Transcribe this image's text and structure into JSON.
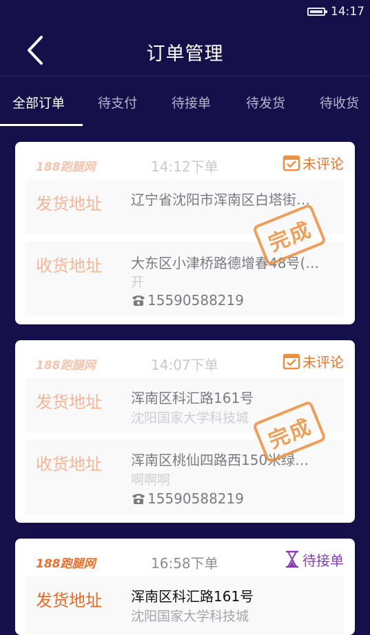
{
  "status_bar": {
    "time": "14:17"
  },
  "header": {
    "title": "订单管理"
  },
  "tabs": [
    {
      "label": "全部订单",
      "active": true
    },
    {
      "label": "待支付",
      "active": false
    },
    {
      "label": "待接单",
      "active": false
    },
    {
      "label": "待发货",
      "active": false
    },
    {
      "label": "待收货",
      "active": false
    }
  ],
  "orders": [
    {
      "logo": "188跑腿网",
      "time": "14:12下单",
      "status": "未评论",
      "status_icon": "check-calendar-icon",
      "stamp": "完成",
      "sender": {
        "label": "发货地址",
        "address": "辽宁省沈阳市浑南区白塔街…",
        "detail": ""
      },
      "receiver": {
        "label": "收货地址",
        "address": "大东区小津桥路德增春48号(…",
        "detail": "开",
        "phone": "15590588219"
      }
    },
    {
      "logo": "188跑腿网",
      "time": "14:07下单",
      "status": "未评论",
      "status_icon": "check-calendar-icon",
      "stamp": "完成",
      "sender": {
        "label": "发货地址",
        "address": "浑南区科汇路161号",
        "detail": "沈阳国家大学科技城"
      },
      "receiver": {
        "label": "收货地址",
        "address": "浑南区桃仙四路西150米绿…",
        "detail": "啊啊啊",
        "phone": "15590588219"
      }
    },
    {
      "logo": "188跑腿网",
      "time": "16:58下单",
      "status": "待接单",
      "status_icon": "hourglass-icon",
      "sender": {
        "label": "发货地址",
        "address": "浑南区科汇路161号",
        "detail": "沈阳国家大学科技城"
      }
    }
  ],
  "colors": {
    "background": "#16104a",
    "accent_orange": "#e8742c",
    "accent_purple": "#8a39b3"
  }
}
